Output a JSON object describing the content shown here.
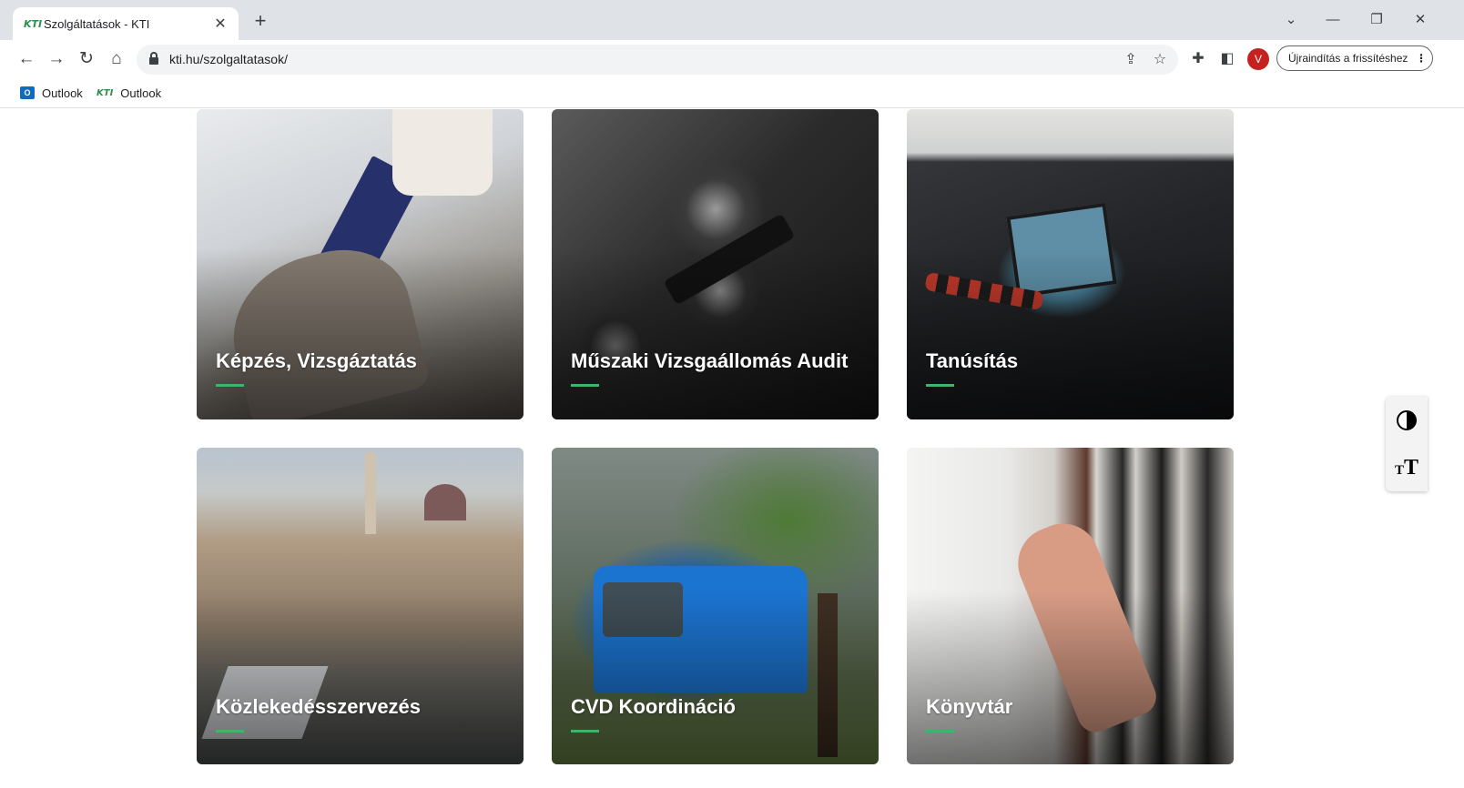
{
  "browser": {
    "tab": {
      "favicon_text": "KTI",
      "title": "Szolgáltatások - KTI",
      "close_symbol": "✕"
    },
    "new_tab_symbol": "+",
    "window_controls": {
      "tab_search": "⌄",
      "minimize": "—",
      "restore": "❐",
      "close": "✕"
    },
    "nav": {
      "back": "←",
      "forward": "→",
      "reload": "↻",
      "home": "⌂"
    },
    "url": "kti.hu/szolgaltatasok/",
    "omnibox_icons": {
      "share": "⇪",
      "bookmark": "☆"
    },
    "toolbar_icons": {
      "extensions": "✚",
      "side_panel": "◧"
    },
    "profile_initial": "V",
    "relaunch_label": "Újraindítás a frissítéshez",
    "menu_symbol": "⋮",
    "bookmarks": [
      {
        "icon": "O",
        "label": "Outlook"
      },
      {
        "icon": "KTI",
        "label": "Outlook"
      }
    ]
  },
  "services": [
    {
      "title": "Képzés, Vizsgáztatás"
    },
    {
      "title": "Műszaki Vizsgaállomás Audit"
    },
    {
      "title": "Tanúsítás"
    },
    {
      "title": "Közlekedésszervezés"
    },
    {
      "title": "CVD Koordináció"
    },
    {
      "title": "Könyvtár"
    }
  ],
  "accessibility": {
    "contrast_icon": "contrast-icon",
    "font_size_icon": "font-size-icon"
  },
  "colors": {
    "accent_green": "#3fb56a",
    "profile_red": "#c5221f",
    "card_text": "#ffffff"
  }
}
